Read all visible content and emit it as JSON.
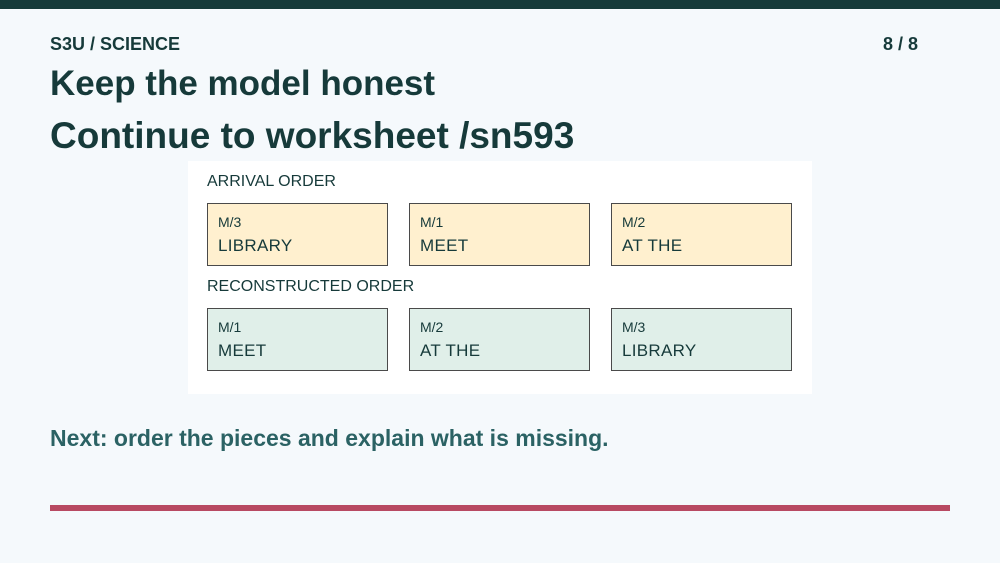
{
  "header": {
    "course": "S3U / SCIENCE",
    "page": "8 / 8"
  },
  "title": "Keep the model honest",
  "subtitle": "Continue to worksheet /sn593",
  "panel": {
    "arrival_label": "ARRIVAL ORDER",
    "arrival": [
      {
        "tag": "M/3",
        "word": "LIBRARY"
      },
      {
        "tag": "M/1",
        "word": "MEET"
      },
      {
        "tag": "M/2",
        "word": "AT THE"
      }
    ],
    "reconstructed_label": "RECONSTRUCTED ORDER",
    "reconstructed": [
      {
        "tag": "M/1",
        "word": "MEET"
      },
      {
        "tag": "M/2",
        "word": "AT THE"
      },
      {
        "tag": "M/3",
        "word": "LIBRARY"
      }
    ]
  },
  "next_prompt": "Next: order the pieces and explain what is missing.",
  "colors": {
    "dark_teal": "#163a3a",
    "arrival_fill": "#fff0cf",
    "reconstructed_fill": "#e0efe9",
    "accent_rule": "#b84a62",
    "prompt_teal": "#2b6264"
  }
}
